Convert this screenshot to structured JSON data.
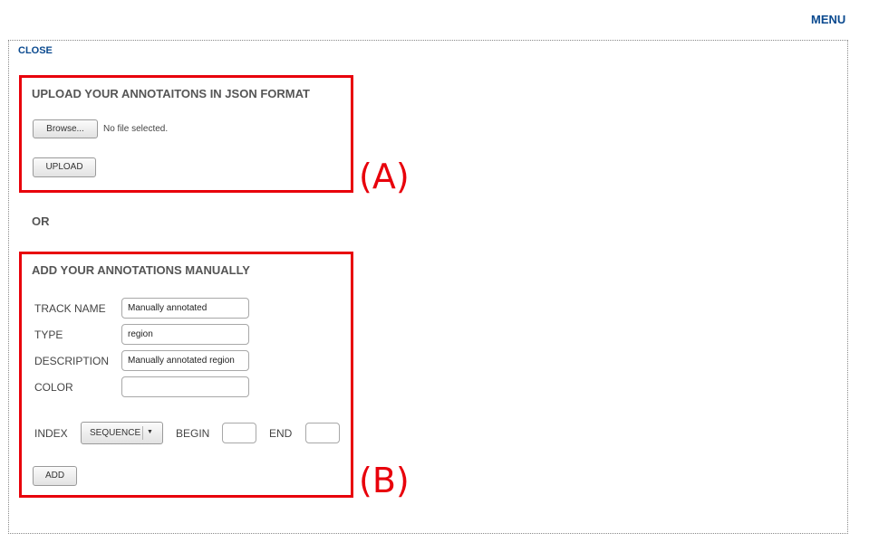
{
  "header": {
    "menu_label": "MENU"
  },
  "panel": {
    "close_label": "CLOSE",
    "upload_section": {
      "title": "UPLOAD YOUR ANNOTAITONS IN JSON FORMAT",
      "browse_label": "Browse...",
      "file_status": "No file selected.",
      "upload_label": "UPLOAD"
    },
    "or_label": "OR",
    "manual_section": {
      "title": "ADD YOUR ANNOTATIONS MANUALLY",
      "track_name": {
        "label": "TRACK NAME",
        "value": "Manually annotated"
      },
      "type": {
        "label": "TYPE",
        "value": "region"
      },
      "description": {
        "label": "DESCRIPTION",
        "value": "Manually annotated region"
      },
      "color": {
        "label": "COLOR",
        "value": ""
      },
      "index": {
        "label": "INDEX",
        "selected": "SEQUENCE",
        "arrow": "▼"
      },
      "begin": {
        "label": "BEGIN",
        "value": ""
      },
      "end": {
        "label": "END",
        "value": ""
      },
      "add_label": "ADD"
    }
  },
  "callouts": {
    "a": "(A)",
    "b": "(B)"
  },
  "colors": {
    "link": "#0b4a8f",
    "highlight": "#e8000b",
    "title_text": "#555555"
  },
  "icons": {
    "dropdown": "chevron-down-icon"
  }
}
